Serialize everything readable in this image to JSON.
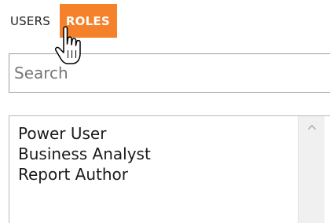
{
  "tabs": {
    "users_label": "USERS",
    "roles_label": "ROLES",
    "active": "roles",
    "accent_color": "#f5822a"
  },
  "search": {
    "placeholder": "Search",
    "value": ""
  },
  "list": {
    "items": [
      "Power User",
      "Business Analyst",
      "Report Author"
    ]
  },
  "icons": {
    "scroll_up": "chevron-up-icon",
    "cursor": "hand-pointer-cursor"
  }
}
